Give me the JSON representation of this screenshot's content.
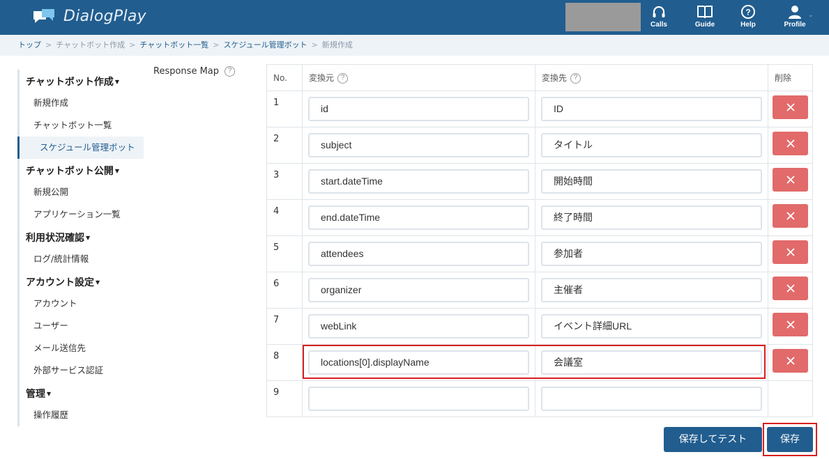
{
  "app": {
    "title": "DialogPlay"
  },
  "header": {
    "nav": [
      {
        "label": "Calls",
        "icon": "headset-icon"
      },
      {
        "label": "Guide",
        "icon": "book-icon"
      },
      {
        "label": "Help",
        "icon": "help-icon"
      },
      {
        "label": "Profile",
        "icon": "user-icon"
      }
    ]
  },
  "breadcrumb": [
    "トップ",
    "チャットボット作成",
    "チャットボット一覧",
    "スケジュール管理ボット",
    "新規作成"
  ],
  "sidebar": {
    "groups": [
      {
        "title": "チャットボット作成",
        "items": [
          "新規作成",
          "チャットボット一覧",
          "スケジュール管理ボット"
        ]
      },
      {
        "title": "チャットボット公開",
        "items": [
          "新規公開",
          "アプリケーション一覧"
        ]
      },
      {
        "title": "利用状況確認",
        "items": [
          "ログ/統計情報"
        ]
      },
      {
        "title": "アカウント設定",
        "items": [
          "アカウント",
          "ユーザー",
          "メール送信先",
          "外部サービス認証"
        ]
      },
      {
        "title": "管理",
        "items": [
          "操作履歴"
        ]
      }
    ]
  },
  "response_map": {
    "label": "Response Map",
    "headers": {
      "no": "No.",
      "source": "変換元",
      "target": "変換先",
      "delete": "削除"
    },
    "rows": [
      {
        "no": "1",
        "source": "id",
        "target": "ID"
      },
      {
        "no": "2",
        "source": "subject",
        "target": "タイトル"
      },
      {
        "no": "3",
        "source": "start.dateTime",
        "target": "開始時間"
      },
      {
        "no": "4",
        "source": "end.dateTime",
        "target": "終了時間"
      },
      {
        "no": "5",
        "source": "attendees",
        "target": "参加者"
      },
      {
        "no": "6",
        "source": "organizer",
        "target": "主催者"
      },
      {
        "no": "7",
        "source": "webLink",
        "target": "イベント詳細URL"
      },
      {
        "no": "8",
        "source": "locations[0].displayName",
        "target": "会議室"
      },
      {
        "no": "9",
        "source": "",
        "target": ""
      }
    ]
  },
  "actions": {
    "save_and_test": "保存してテスト",
    "save": "保存"
  },
  "colors": {
    "header_bg": "#215d8f",
    "delete_btn": "#e26a6a",
    "highlight": "#d81f1f"
  }
}
